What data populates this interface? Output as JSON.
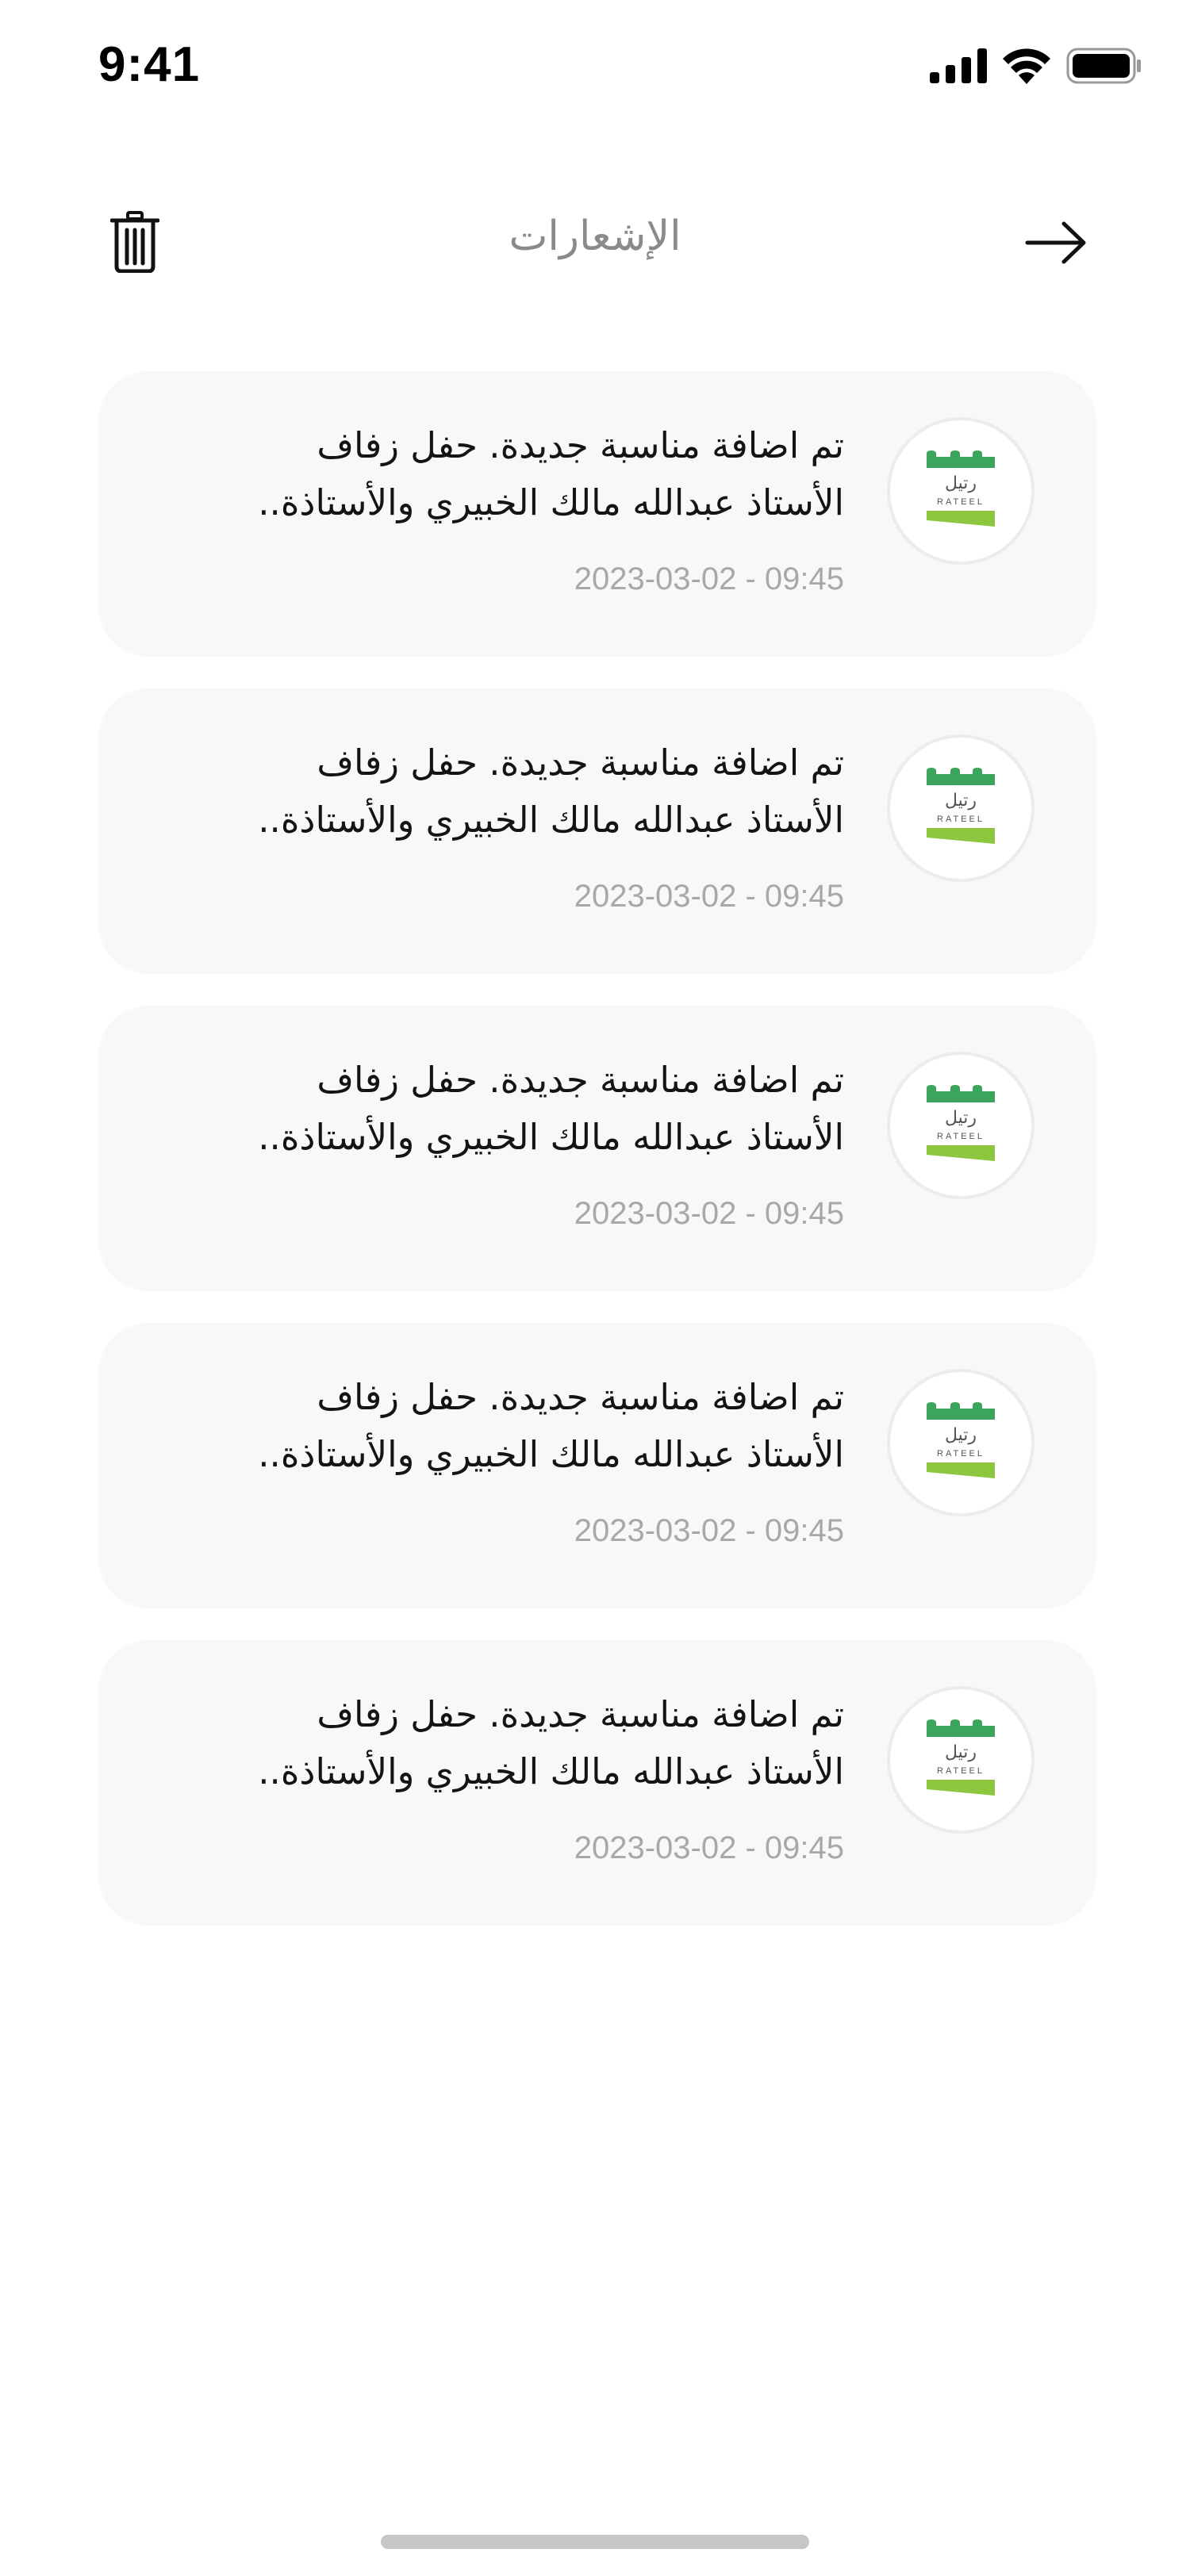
{
  "status_bar": {
    "time": "9:41"
  },
  "header": {
    "title": "الإشعارات",
    "delete_icon": "trash-icon",
    "back_icon": "arrow-right-icon"
  },
  "brand": {
    "logo_text_ar": "رتيل",
    "logo_text_en": "RATEEL",
    "green_dark": "#3aa55b",
    "green_light": "#8dc63f"
  },
  "notifications": [
    {
      "line1": "تم اضافة مناسبة جديدة. حفل زفاف",
      "line2": "الأستاذ عبدالله مالك الخبيري والأستاذة..",
      "date": "2023-03-02 - 09:45"
    },
    {
      "line1": "تم اضافة مناسبة جديدة. حفل زفاف",
      "line2": "الأستاذ عبدالله مالك الخبيري والأستاذة..",
      "date": "2023-03-02 - 09:45"
    },
    {
      "line1": "تم اضافة مناسبة جديدة. حفل زفاف",
      "line2": "الأستاذ عبدالله مالك الخبيري والأستاذة..",
      "date": "2023-03-02 - 09:45"
    },
    {
      "line1": "تم اضافة مناسبة جديدة. حفل زفاف",
      "line2": "الأستاذ عبدالله مالك الخبيري والأستاذة..",
      "date": "2023-03-02 - 09:45"
    },
    {
      "line1": "تم اضافة مناسبة جديدة. حفل زفاف",
      "line2": "الأستاذ عبدالله مالك الخبيري والأستاذة..",
      "date": "2023-03-02 - 09:45"
    }
  ]
}
